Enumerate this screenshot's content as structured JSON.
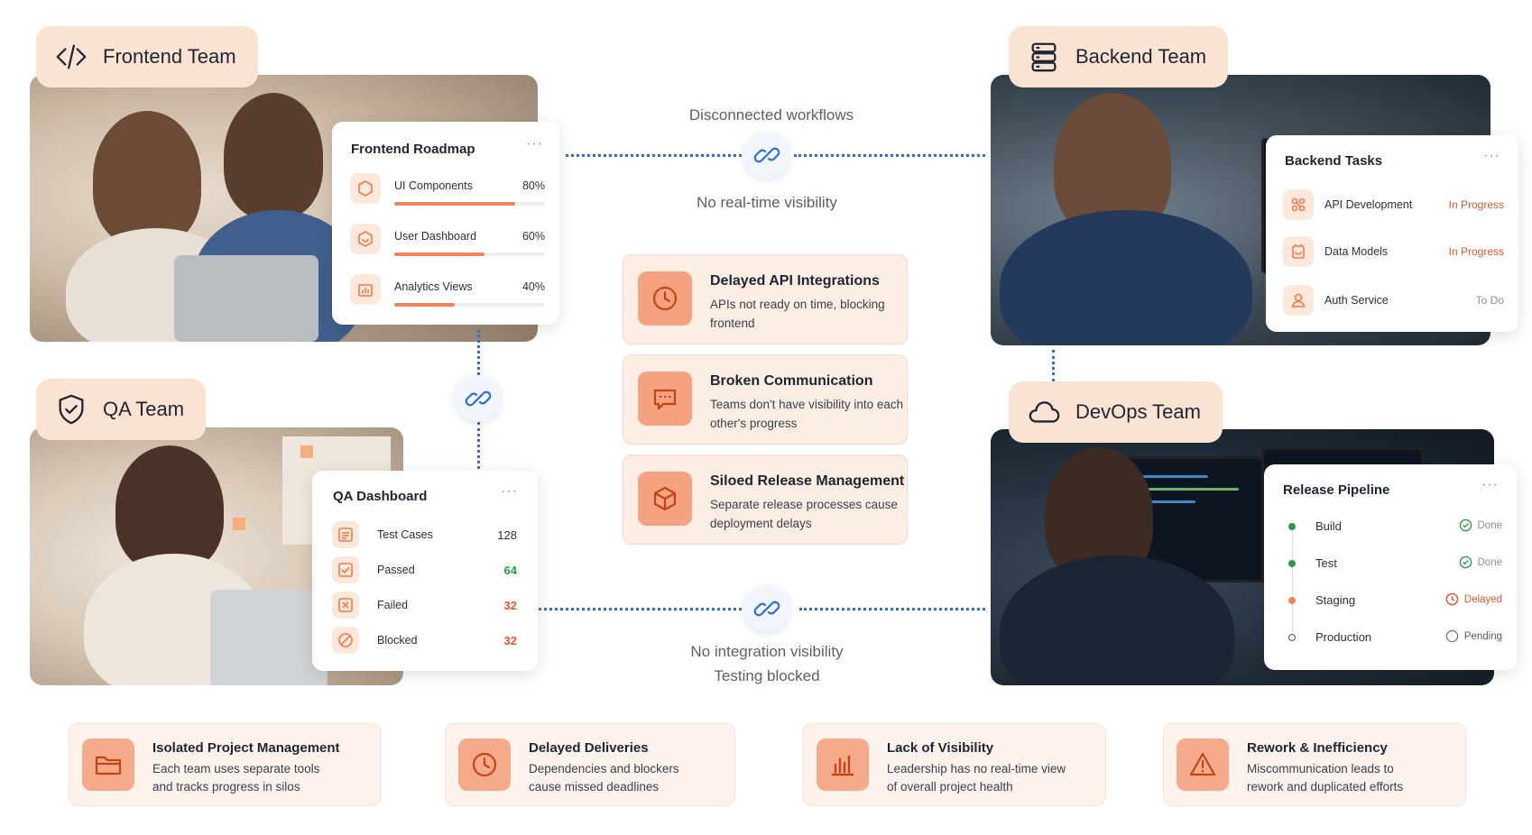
{
  "colors": {
    "accent": "#f0845a",
    "tab_bg": "#fbe3d3",
    "connector": "#2f6fd1",
    "success": "#2e9a4e",
    "danger": "#e0572b"
  },
  "frontend": {
    "team_title": "Frontend Team",
    "icon": "code-icon",
    "card_title": "Frontend Roadmap",
    "menu": "···",
    "items": [
      {
        "label": "UI Components",
        "value": "80%",
        "progress": 0.8,
        "icon": "hexagon-icon"
      },
      {
        "label": "User Dashboard",
        "value": "60%",
        "progress": 0.6,
        "icon": "dashboard-icon"
      },
      {
        "label": "Analytics Views",
        "value": "40%",
        "progress": 0.4,
        "icon": "bar-chart-icon"
      }
    ]
  },
  "backend": {
    "team_title": "Backend Team",
    "icon": "server-icon",
    "card_title": "Backend Tasks",
    "menu": "···",
    "items": [
      {
        "label": "API Development",
        "status": "In Progress",
        "icon": "api-icon"
      },
      {
        "label": "Data Models",
        "status": "In Progress",
        "icon": "database-icon"
      },
      {
        "label": "Auth Service",
        "status": "To Do",
        "icon": "user-icon"
      }
    ]
  },
  "qa": {
    "team_title": "QA Team",
    "icon": "shield-check-icon",
    "card_title": "QA Dashboard",
    "menu": "···",
    "items": [
      {
        "label": "Test Cases",
        "value": "128",
        "icon": "list-icon"
      },
      {
        "label": "Passed",
        "value": "64",
        "icon": "check-square-icon"
      },
      {
        "label": "Failed",
        "value": "32",
        "icon": "x-square-icon"
      },
      {
        "label": "Blocked",
        "value": "32",
        "icon": "blocked-icon"
      }
    ]
  },
  "devops": {
    "team_title": "DevOps Team",
    "icon": "cloud-icon",
    "card_title": "Release Pipeline",
    "menu": "···",
    "stages": [
      {
        "label": "Build",
        "status": "Done"
      },
      {
        "label": "Test",
        "status": "Done"
      },
      {
        "label": "Staging",
        "status": "Delayed"
      },
      {
        "label": "Production",
        "status": "Pending"
      }
    ]
  },
  "center": {
    "top_label": "Disconnected workflows",
    "top_sub": "No real-time visibility",
    "bottom_label": "No integration visibility",
    "bottom_sub": "Testing blocked"
  },
  "issues": [
    {
      "title": "Delayed API Integrations",
      "desc": "APIs not ready on time, blocking frontend",
      "icon": "clock-icon"
    },
    {
      "title": "Broken Communication",
      "desc": "Teams don't have visibility into each other's progress",
      "icon": "chat-icon"
    },
    {
      "title": "Siloed Release Management",
      "desc": "Separate release processes cause deployment delays",
      "icon": "box-icon"
    }
  ],
  "summary": [
    {
      "title": "Isolated Project Management",
      "line1": "Each team uses separate tools",
      "line2": "and tracks progress in silos",
      "icon": "folder-icon"
    },
    {
      "title": "Delayed Deliveries",
      "line1": "Dependencies and blockers",
      "line2": "cause missed deadlines",
      "icon": "clock-icon"
    },
    {
      "title": "Lack of Visibility",
      "line1": "Leadership has no real-time view",
      "line2": "of overall project health",
      "icon": "bar-chart-icon"
    },
    {
      "title": "Rework & Inefficiency",
      "line1": "Miscommunication leads to",
      "line2": "rework and duplicated efforts",
      "icon": "warning-icon"
    }
  ]
}
